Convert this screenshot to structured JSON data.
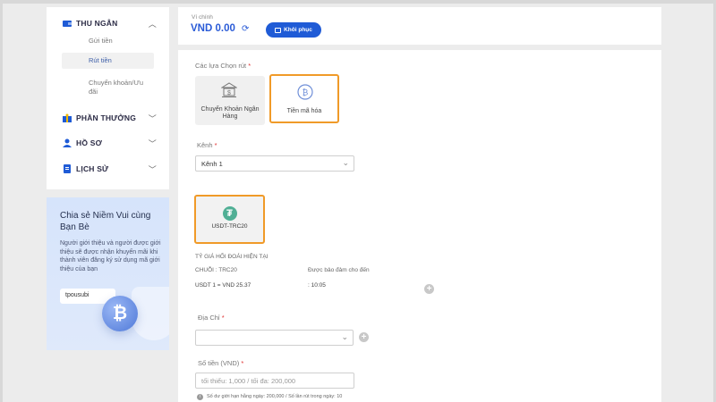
{
  "sidebar": {
    "cashier": {
      "label": "THU NGÂN",
      "items": [
        "Gửi tiền",
        "Rút tiền",
        "Chuyển khoản/Ưu đãi"
      ]
    },
    "rewards": {
      "label": "PHẦN THƯỞNG"
    },
    "profile": {
      "label": "HỒ SƠ"
    },
    "history": {
      "label": "LỊCH SỬ"
    }
  },
  "promo": {
    "title": "Chia sẻ Niềm Vui cùng Bạn Bè",
    "text": "Người giới thiệu và người được giới thiệu sẽ được nhận khuyến mãi khi thành viên đăng ký sử dụng mã giới thiệu của bạn",
    "code": "tpousubi",
    "coin_symbol": "₿"
  },
  "wallet": {
    "label": "Ví chính",
    "balance": "VND 0.00",
    "restore_label": "Khôi phục"
  },
  "withdraw": {
    "options_label": "Các lựa Chọn rút",
    "methods": [
      {
        "label": "Chuyển Khoản Ngân Hàng",
        "icon": "bank-icon"
      },
      {
        "label": "Tiền mã hóa",
        "icon": "crypto-coin-icon"
      }
    ],
    "channel_label": "Kênh",
    "channel_value": "Kênh 1",
    "coin": {
      "label": "USDT-TRC20",
      "icon": "tether-icon"
    },
    "rate_title": "TỶ GIÁ HỐI ĐOÁI HIỆN TẠI",
    "chain": "CHUỖI : TRC20",
    "guaranteed_label": "Được bảo đảm cho đến",
    "rate": "USDT 1 = VND 25.37",
    "guaranteed_time": ": 10:05",
    "address_label": "Địa Chỉ",
    "address_value": "",
    "amount_label": "Số tiền (VND)",
    "amount_placeholder": "tối thiểu: 1,000 / tối đa: 200,000",
    "limit_note": "Số dư giới hạn hằng ngày: 200,000 / Số lần rút trong ngày: 10"
  },
  "colors": {
    "accent": "#1f5bd6",
    "selected_border": "#f09a28",
    "tether": "#50af95"
  }
}
